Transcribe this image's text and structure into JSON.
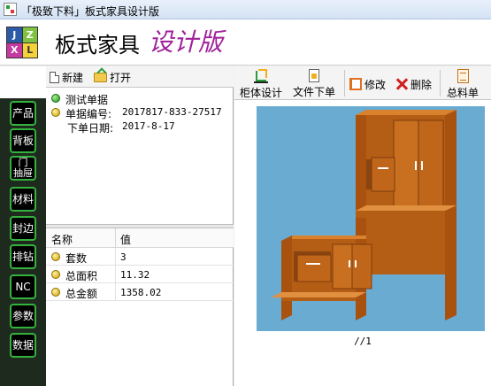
{
  "window": {
    "title": "「极致下料」板式家具设计版"
  },
  "header": {
    "logo_letters": [
      "J",
      "Z",
      "X",
      "L"
    ],
    "brand": "板式家具",
    "edition": "设计版"
  },
  "sidebar": {
    "items": [
      {
        "label": "产品"
      },
      {
        "label": "背板"
      },
      {
        "label": "门\n抽屉"
      },
      {
        "label": "材料"
      },
      {
        "label": "封边"
      },
      {
        "label": "排钻"
      },
      {
        "label": "NC"
      },
      {
        "label": "参数"
      },
      {
        "label": "数据"
      }
    ]
  },
  "project_toolbar": {
    "new_label": "新建",
    "open_label": "打开"
  },
  "project": {
    "name": "测试单据",
    "order_label": "单据编号:",
    "order_no": "2017817-833-27517",
    "date_label": "下单日期:",
    "date": "2017-8-17"
  },
  "summary": {
    "col_name": "名称",
    "col_value": "值",
    "rows": [
      {
        "name": "套数",
        "value": "3"
      },
      {
        "name": "总面积",
        "value": "11.32"
      },
      {
        "name": "总金额",
        "value": "1358.02"
      }
    ]
  },
  "design_toolbar": {
    "cabinet_design": "柜体设计",
    "file_order": "文件下单",
    "modify": "修改",
    "delete": "删除",
    "summary_sheet": "总料单"
  },
  "preview": {
    "caption": "//1"
  },
  "colors": {
    "viewport_bg": "#6aabd2",
    "wood": "#c0661a",
    "wood_dark": "#8a4410",
    "nav_border": "#34b23d",
    "edition_text": "#a0209a"
  }
}
